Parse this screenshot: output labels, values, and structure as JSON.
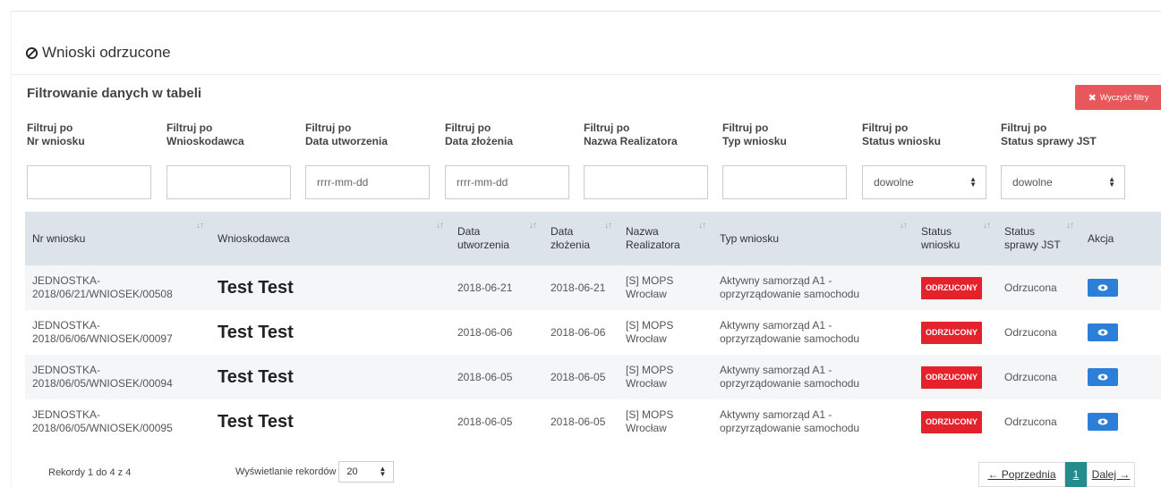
{
  "page": {
    "title": "Wnioski odrzucone"
  },
  "filters": {
    "heading": "Filtrowanie danych w tabeli",
    "clear_label": "Wyczyść filtry",
    "items": [
      {
        "line1": "Filtruj po",
        "line2": "Nr wniosku",
        "value": "",
        "placeholder": ""
      },
      {
        "line1": "Filtruj po",
        "line2": "Wnioskodawca",
        "value": "",
        "placeholder": ""
      },
      {
        "line1": "Filtruj po",
        "line2": "Data utworzenia",
        "value": "",
        "placeholder": "rrrr-mm-dd"
      },
      {
        "line1": "Filtruj po",
        "line2": "Data złożenia",
        "value": "",
        "placeholder": "rrrr-mm-dd"
      },
      {
        "line1": "Filtruj po",
        "line2": "Nazwa Realizatora",
        "value": "",
        "placeholder": ""
      },
      {
        "line1": "Filtruj po",
        "line2": "Typ wniosku",
        "value": "",
        "placeholder": ""
      },
      {
        "line1": "Filtruj po",
        "line2": "Status wniosku",
        "selected": "dowolne"
      },
      {
        "line1": "Filtruj po",
        "line2": "Status sprawy JST",
        "selected": "dowolne"
      }
    ]
  },
  "table": {
    "headers": {
      "nr": "Nr wniosku",
      "wnioskodawca": "Wnioskodawca",
      "data_utw_1": "Data",
      "data_utw_2": "utworzenia",
      "data_zl_1": "Data",
      "data_zl_2": "złożenia",
      "realizator_1": "Nazwa",
      "realizator_2": "Realizatora",
      "typ": "Typ wniosku",
      "status_1": "Status",
      "status_2": "wniosku",
      "jst_1": "Status",
      "jst_2": "sprawy JST",
      "akcja": "Akcja"
    },
    "rows": [
      {
        "nr1": "JEDNOSTKA-",
        "nr2": "2018/06/21/WNIOSEK/00508",
        "wnioskodawca": "Test Test",
        "data_utw": "2018-06-21",
        "data_zl": "2018-06-21",
        "real1": "[S] MOPS",
        "real2": "Wrocław",
        "typ1": "Aktywny samorząd A1 -",
        "typ2": "oprzyrządowanie samochodu",
        "status": "ODRZUCONY",
        "jst": "Odrzucona"
      },
      {
        "nr1": "JEDNOSTKA-",
        "nr2": "2018/06/06/WNIOSEK/00097",
        "wnioskodawca": "Test Test",
        "data_utw": "2018-06-06",
        "data_zl": "2018-06-06",
        "real1": "[S] MOPS",
        "real2": "Wrocław",
        "typ1": "Aktywny samorząd A1 -",
        "typ2": "oprzyrządowanie samochodu",
        "status": "ODRZUCONY",
        "jst": "Odrzucona"
      },
      {
        "nr1": "JEDNOSTKA-",
        "nr2": "2018/06/05/WNIOSEK/00094",
        "wnioskodawca": "Test Test",
        "data_utw": "2018-06-05",
        "data_zl": "2018-06-05",
        "real1": "[S] MOPS",
        "real2": "Wrocław",
        "typ1": "Aktywny samorząd A1 -",
        "typ2": "oprzyrządowanie samochodu",
        "status": "ODRZUCONY",
        "jst": "Odrzucona"
      },
      {
        "nr1": "JEDNOSTKA-",
        "nr2": "2018/06/05/WNIOSEK/00095",
        "wnioskodawca": "Test Test",
        "data_utw": "2018-06-05",
        "data_zl": "2018-06-05",
        "real1": "[S] MOPS",
        "real2": "Wrocław",
        "typ1": "Aktywny samorząd A1 -",
        "typ2": "oprzyrządowanie samochodu",
        "status": "ODRZUCONY",
        "jst": "Odrzucona"
      }
    ]
  },
  "footer": {
    "records": "Rekordy 1 do 4 z 4",
    "per_page_label": "Wyświetlanie rekordów",
    "per_page_value": "20",
    "prev": "← Poprzednia",
    "current": "1",
    "next": "Dalej →"
  },
  "colors": {
    "danger": "#e3222c",
    "primary": "#2b7fd8",
    "pager_active": "#248c8d",
    "header_bg": "#dde3ea"
  }
}
